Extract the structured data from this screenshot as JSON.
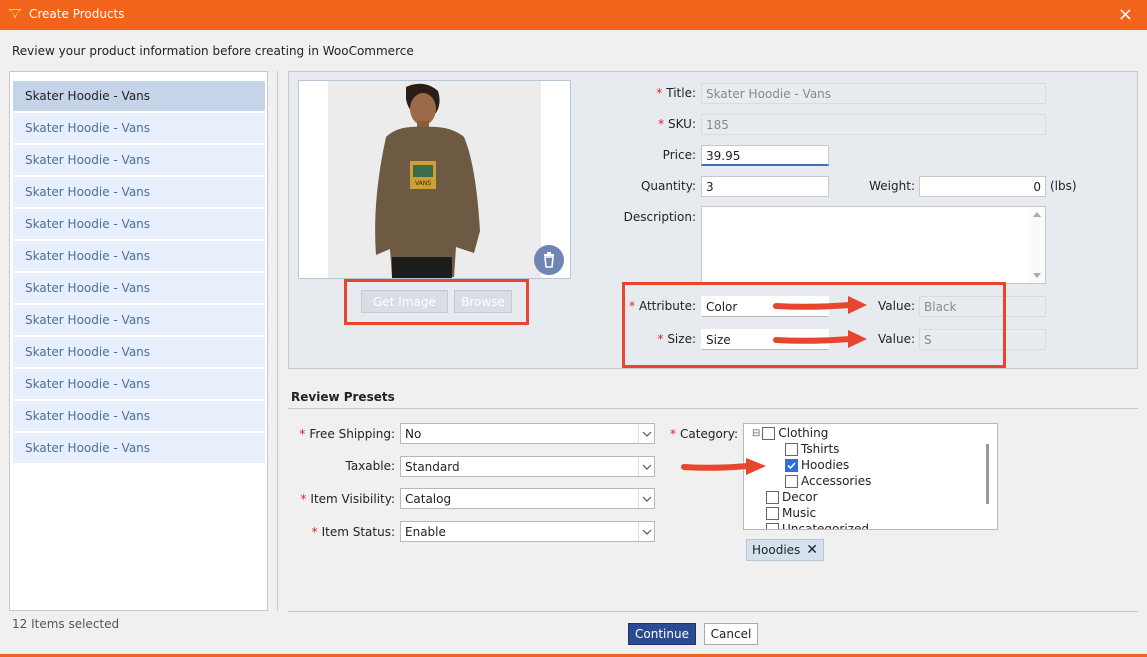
{
  "window": {
    "title": "Create Products",
    "close_icon": "×"
  },
  "subtitle": "Review your product information before creating in WooCommerce",
  "product_list": {
    "items": [
      "Skater Hoodie - Vans",
      "Skater Hoodie - Vans",
      "Skater Hoodie - Vans",
      "Skater Hoodie - Vans",
      "Skater Hoodie - Vans",
      "Skater Hoodie - Vans",
      "Skater Hoodie - Vans",
      "Skater Hoodie - Vans",
      "Skater Hoodie - Vans",
      "Skater Hoodie - Vans",
      "Skater Hoodie - Vans",
      "Skater Hoodie - Vans"
    ],
    "selected_index": 0,
    "count_text": "12 Items selected"
  },
  "image": {
    "get_image_label": "Get Image",
    "browse_label": "Browse",
    "delete_icon": "trash-icon",
    "graphic_text": "VANS"
  },
  "form": {
    "required_mark": "*",
    "title_label": "Title:",
    "title_value": "Skater Hoodie - Vans",
    "sku_label": "SKU:",
    "sku_value": "185",
    "price_label": "Price:",
    "price_value": "39.95",
    "quantity_label": "Quantity:",
    "quantity_value": "3",
    "weight_label": "Weight:",
    "weight_value": "0",
    "weight_unit": "(lbs)",
    "description_label": "Description:",
    "description_value": "",
    "attribute_label": "Attribute:",
    "attribute_value": "Color",
    "attribute_value_label": "Value:",
    "attribute_value_value": "Black",
    "size_label": "Size:",
    "size_value": "Size",
    "size_value_label": "Value:",
    "size_value_value": "S"
  },
  "presets": {
    "section_title": "Review Presets",
    "free_shipping_label": "Free Shipping:",
    "free_shipping_value": "No",
    "taxable_label": "Taxable:",
    "taxable_value": "Standard",
    "item_visibility_label": "Item Visibility:",
    "item_visibility_value": "Catalog",
    "item_status_label": "Item Status:",
    "item_status_value": "Enable",
    "category_label": "Category:",
    "categories": [
      {
        "label": "Clothing",
        "checked": false,
        "level": 0,
        "expander": "⊟"
      },
      {
        "label": "Tshirts",
        "checked": false,
        "level": 1
      },
      {
        "label": "Hoodies",
        "checked": true,
        "level": 1
      },
      {
        "label": "Accessories",
        "checked": false,
        "level": 1
      },
      {
        "label": "Decor",
        "checked": false,
        "level": 0
      },
      {
        "label": "Music",
        "checked": false,
        "level": 0
      },
      {
        "label": "Uncategorized",
        "checked": false,
        "level": 0
      }
    ],
    "selected_tag": "Hoodies",
    "tag_remove_icon": "✕"
  },
  "buttons": {
    "continue_label": "Continue",
    "cancel_label": "Cancel"
  },
  "colors": {
    "brand": "#f2631b",
    "annotation": "#e8452f",
    "primary": "#2a4a91"
  }
}
